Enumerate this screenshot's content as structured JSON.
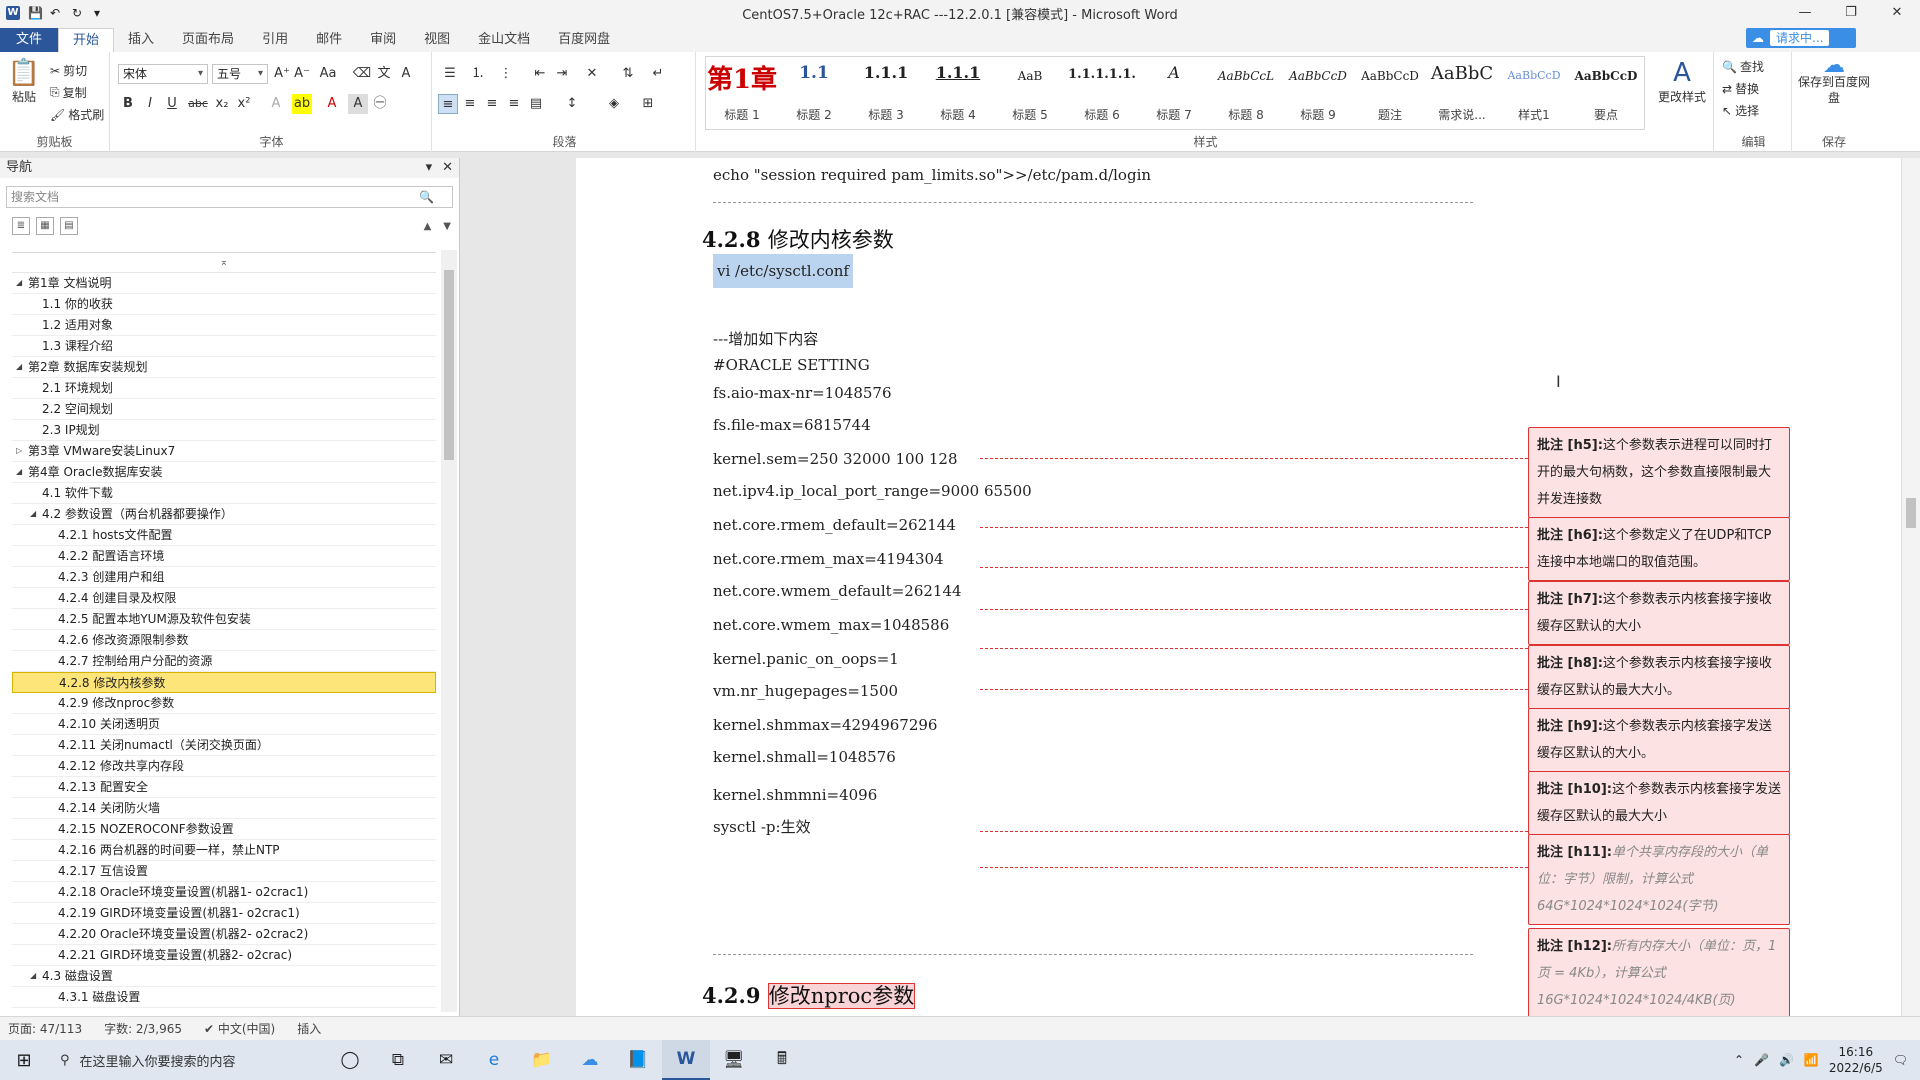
{
  "window": {
    "title": "CentOS7.5+Oracle 12c+RAC ---12.2.0.1 [兼容模式] - Microsoft Word",
    "buttons": {
      "minimize": "—",
      "restore": "❐",
      "close": "✕"
    }
  },
  "ribbon_tabs": [
    "文件",
    "开始",
    "插入",
    "页面布局",
    "引用",
    "邮件",
    "审阅",
    "视图",
    "金山文档",
    "百度网盘"
  ],
  "ask": {
    "placeholder": "请求中..."
  },
  "clipboard": {
    "paste": "粘贴",
    "cut": "剪切",
    "copy": "复制",
    "format_painter": "格式刷",
    "group": "剪贴板"
  },
  "font": {
    "family": "宋体",
    "size": "五号",
    "group": "字体"
  },
  "paragraph": {
    "group": "段落"
  },
  "styles": {
    "group": "样式",
    "items": [
      {
        "preview": "第1章",
        "name": "标题 1"
      },
      {
        "preview": "1.1",
        "name": "标题 2"
      },
      {
        "preview": "1.1.1",
        "name": "标题 3"
      },
      {
        "preview": "1.1.1",
        "name": "标题 4"
      },
      {
        "preview": "AaB",
        "name": "标题 5"
      },
      {
        "preview": "1.1.1.1.1.",
        "name": "标题 6"
      },
      {
        "preview": "A",
        "name": "标题 7"
      },
      {
        "preview": "AaBbCcL",
        "name": "标题 8"
      },
      {
        "preview": "AaBbCcD",
        "name": "标题 9"
      },
      {
        "preview": "AaBbCcD",
        "name": "题注"
      },
      {
        "preview": "AaBbC",
        "name": "需求说..."
      },
      {
        "preview": "AaBbCcD",
        "name": "样式1"
      },
      {
        "preview": "AaBbCcD",
        "name": "要点"
      }
    ],
    "change": "更改样式"
  },
  "editing": {
    "find": "查找",
    "replace": "替换",
    "select": "选择",
    "group": "编辑"
  },
  "save": {
    "label": "保存到百度网盘",
    "group": "保存"
  },
  "nav": {
    "title": "导航",
    "search_placeholder": "搜索文档",
    "items": [
      {
        "level": 1,
        "text": "第1章  文档说明",
        "toggle": "◢"
      },
      {
        "level": 2,
        "text": "1.1 你的收获"
      },
      {
        "level": 2,
        "text": "1.2 适用对象"
      },
      {
        "level": 2,
        "text": "1.3 课程介绍"
      },
      {
        "level": 1,
        "text": "第2章  数据库安装规划",
        "toggle": "◢"
      },
      {
        "level": 2,
        "text": "2.1 环境规划"
      },
      {
        "level": 2,
        "text": "2.2 空间规划"
      },
      {
        "level": 2,
        "text": "2.3 IP规划"
      },
      {
        "level": 1,
        "text": "第3章  VMware安装Linux7",
        "toggle": "▷"
      },
      {
        "level": 1,
        "text": "第4章  Oracle数据库安装",
        "toggle": "◢"
      },
      {
        "level": 2,
        "text": "4.1 软件下载"
      },
      {
        "level": 2,
        "text": "4.2 参数设置（两台机器都要操作）",
        "toggle": "◢"
      },
      {
        "level": 3,
        "text": "4.2.1 hosts文件配置"
      },
      {
        "level": 3,
        "text": "4.2.2 配置语言环境"
      },
      {
        "level": 3,
        "text": "4.2.3 创建用户和组"
      },
      {
        "level": 3,
        "text": "4.2.4 创建目录及权限"
      },
      {
        "level": 3,
        "text": "4.2.5 配置本地YUM源及软件包安装"
      },
      {
        "level": 3,
        "text": "4.2.6 修改资源限制参数"
      },
      {
        "level": 3,
        "text": "4.2.7 控制给用户分配的资源"
      },
      {
        "level": 3,
        "text": "4.2.8 修改内核参数",
        "selected": true
      },
      {
        "level": 3,
        "text": "4.2.9 修改nproc参数"
      },
      {
        "level": 3,
        "text": "4.2.10 关闭透明页"
      },
      {
        "level": 3,
        "text": "4.2.11 关闭numactl（关闭交换页面）"
      },
      {
        "level": 3,
        "text": "4.2.12 修改共享内存段"
      },
      {
        "level": 3,
        "text": "4.2.13 配置安全"
      },
      {
        "level": 3,
        "text": "4.2.14 关闭防火墙"
      },
      {
        "level": 3,
        "text": "4.2.15 NOZEROCONF参数设置"
      },
      {
        "level": 3,
        "text": "4.2.16 两台机器的时间要一样，禁止NTP"
      },
      {
        "level": 3,
        "text": "4.2.17 互信设置"
      },
      {
        "level": 3,
        "text": "4.2.18 Oracle环境变量设置(机器1- o2crac1)"
      },
      {
        "level": 3,
        "text": "4.2.19 GIRD环境变量设置(机器1- o2crac1)"
      },
      {
        "level": 3,
        "text": "4.2.20 Oracle环境变量设置(机器2- o2crac2)"
      },
      {
        "level": 3,
        "text": "4.2.21 GIRD环境变量设置(机器2- o2crac)"
      },
      {
        "level": 2,
        "text": "4.3 磁盘设置",
        "toggle": "◢"
      },
      {
        "level": 3,
        "text": "4.3.1 磁盘设置"
      }
    ]
  },
  "doc": {
    "top_line": "echo \"session required pam_limits.so\">>/etc/pam.d/login",
    "heading1": {
      "num": "4.2.8",
      "text": "修改内核参数"
    },
    "selected_line": "vi /etc/sysctl.conf",
    "lines": [
      "---增加如下内容",
      "#ORACLE SETTING",
      "fs.aio-max-nr=1048576",
      "fs.file-max=6815744",
      "kernel.sem=250 32000 100 128",
      "net.ipv4.ip_local_port_range=9000 65500",
      "net.core.rmem_default=262144",
      "net.core.rmem_max=4194304",
      "net.core.wmem_default=262144",
      "net.core.wmem_max=1048586",
      "kernel.panic_on_oops=1",
      "vm.nr_hugepages=1500",
      "kernel.shmmax=4294967296",
      "kernel.shmall=1048576",
      "kernel.shmmni=4096",
      "sysctl -p:生效"
    ],
    "heading2": {
      "num": "4.2.9",
      "text": "修改nproc参数"
    }
  },
  "comments": [
    {
      "tag": "批注 [h5]:",
      "text": "这个参数表示进程可以同时打开的最大句柄数，这个参数直接限制最大并发连接数"
    },
    {
      "tag": "批注 [h6]:",
      "text": "这个参数定义了在UDP和TCP连接中本地端口的取值范围。"
    },
    {
      "tag": "批注 [h7]:",
      "text": "这个参数表示内核套接字接收缓存区默认的大小"
    },
    {
      "tag": "批注 [h8]:",
      "text": "这个参数表示内核套接字接收缓存区默认的最大大小。"
    },
    {
      "tag": "批注 [h9]:",
      "text": "这个参数表示内核套接字发送缓存区默认的大小。"
    },
    {
      "tag": "批注 [h10]:",
      "text": "这个参数表示内核套接字发送缓存区默认的最大大小"
    },
    {
      "tag": "批注 [h11]:",
      "text": "单个共享内存段的大小（单位：字节）限制，计算公式64G*1024*1024*1024(字节)"
    },
    {
      "tag": "批注 [h12]:",
      "text": "所有内存大小（单位：页，1页 = 4Kb），计算公式16G*1024*1024*1024/4KB(页)"
    }
  ],
  "status": {
    "page": "页面: 47/113",
    "words": "字数: 2/3,965",
    "lang": "中文(中国)",
    "mode": "插入"
  },
  "taskbar": {
    "search_placeholder": "在这里输入你要搜索的内容",
    "time": "16:16",
    "date": "2022/6/5"
  }
}
